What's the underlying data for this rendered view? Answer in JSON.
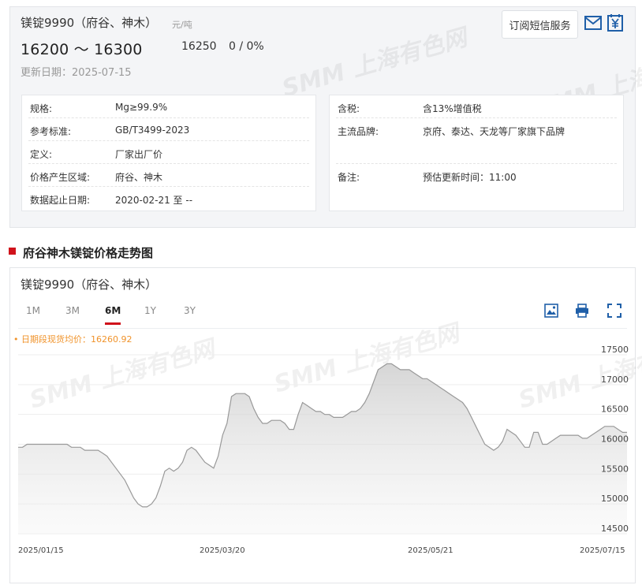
{
  "product": {
    "title": "镁锭9990（府谷、神木）",
    "unit": "元/吨",
    "price_range": "16200 ～ 16300",
    "avg_price": "16250",
    "change": "0 / 0%",
    "update_date": "更新日期：2025-07-15"
  },
  "actions": {
    "subscribe_label": "订阅短信服务"
  },
  "specs_left": [
    {
      "label": "规格:",
      "value": "Mg≥99.9%"
    },
    {
      "label": "参考标准:",
      "value": "GB/T3499-2023"
    },
    {
      "label": "定义:",
      "value": "厂家出厂价"
    },
    {
      "label": "价格产生区域:",
      "value": "府谷、神木"
    },
    {
      "label": "数据起止日期:",
      "value": "2020-02-21 至 --"
    }
  ],
  "specs_right": [
    {
      "label": "含税:",
      "value": "含13%增值税"
    },
    {
      "label": "主流品牌:",
      "value": "京府、泰达、天龙等厂家旗下品牌"
    },
    {
      "label": "备注:",
      "value": "预估更新时间：11:00"
    }
  ],
  "section": {
    "title": "府谷神木镁锭价格走势图"
  },
  "chart_panel": {
    "title": "镁锭9990（府谷、神木）",
    "tabs": [
      "1M",
      "3M",
      "6M",
      "1Y",
      "3Y"
    ],
    "active_tab": "6M",
    "avg_label": "• 日期段现货均价：16260.92"
  },
  "watermark_text": "SMM 上海有色网",
  "colors": {
    "accent_red": "#d0121b",
    "avg_orange": "#f0932b",
    "icon_blue": "#1f5fa8",
    "line_gray": "#999999"
  },
  "chart_data": {
    "type": "area",
    "x_ticks": [
      "2025/01/15",
      "2025/03/20",
      "2025/05/21",
      "2025/07/15"
    ],
    "y_ticks": [
      14500,
      15000,
      15500,
      16000,
      16500,
      17000,
      17500
    ],
    "ylim": [
      14500,
      17500
    ],
    "grid": true,
    "series": [
      {
        "values": [
          15950,
          15950,
          16000,
          16000,
          16000,
          16000,
          16000,
          16000,
          16000,
          16000,
          16000,
          16000,
          15950,
          15950,
          15950,
          15900,
          15900,
          15900,
          15900,
          15850,
          15800,
          15700,
          15600,
          15500,
          15400,
          15250,
          15100,
          15000,
          14950,
          14950,
          15000,
          15100,
          15300,
          15550,
          15600,
          15550,
          15600,
          15700,
          15900,
          15950,
          15900,
          15800,
          15700,
          15650,
          15600,
          15800,
          16150,
          16350,
          16800,
          16850,
          16850,
          16850,
          16800,
          16600,
          16450,
          16350,
          16350,
          16400,
          16400,
          16400,
          16350,
          16250,
          16250,
          16500,
          16700,
          16650,
          16600,
          16550,
          16550,
          16500,
          16500,
          16450,
          16450,
          16450,
          16500,
          16550,
          16550,
          16600,
          16700,
          16850,
          17050,
          17250,
          17300,
          17350,
          17350,
          17300,
          17250,
          17250,
          17250,
          17200,
          17150,
          17100,
          17100,
          17050,
          17000,
          16950,
          16900,
          16850,
          16800,
          16750,
          16700,
          16600,
          16450,
          16300,
          16150,
          16000,
          15950,
          15900,
          15950,
          16050,
          16250,
          16200,
          16150,
          16050,
          15950,
          15950,
          16200,
          16200,
          16000,
          16000,
          16050,
          16100,
          16150,
          16150,
          16150,
          16150,
          16150,
          16100,
          16100,
          16150,
          16200,
          16250,
          16300,
          16300,
          16300,
          16250,
          16200,
          16200
        ]
      }
    ]
  }
}
